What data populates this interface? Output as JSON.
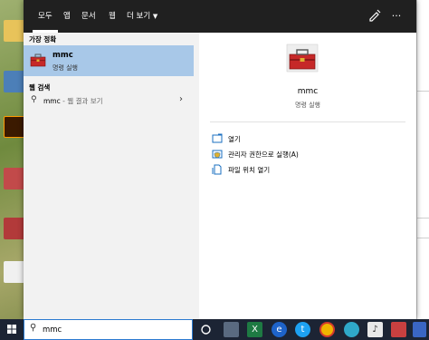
{
  "tabs": [
    {
      "label": "모두",
      "active": true
    },
    {
      "label": "앱"
    },
    {
      "label": "문서"
    },
    {
      "label": "웹"
    },
    {
      "label": "더 보기"
    }
  ],
  "header_icons": [
    "feedback-icon",
    "more-options-icon"
  ],
  "left": {
    "best_match_heading": "가장 정확",
    "best_match": {
      "title": "mmc",
      "subtitle": "명령 실행",
      "icon": "toolbox-icon"
    },
    "web_heading": "웹 검색",
    "web_result": {
      "query": "mmc",
      "suffix": " - 웹 결과 보기"
    }
  },
  "right": {
    "app_name": "mmc",
    "app_type": "명령 실행",
    "actions": [
      {
        "label": "열기",
        "icon": "open-icon"
      },
      {
        "label": "관리자 권한으로 실행(A)",
        "icon": "admin-shield-icon"
      },
      {
        "label": "파일 위치 열기",
        "icon": "file-location-icon"
      }
    ]
  },
  "taskbar": {
    "search_value": "mmc",
    "items": [
      "task-view-icon",
      "people-app-icon",
      "excel-icon",
      "edge-icon",
      "twitter-icon",
      "chrome-icon",
      "edge-new-icon",
      "music-icon",
      "calendar-icon",
      "store-icon"
    ]
  },
  "colors": {
    "tabbar": "#202020",
    "selection": "#a8c8e8",
    "taskbar": "#1c2434",
    "search_border": "#2a7ad0"
  }
}
